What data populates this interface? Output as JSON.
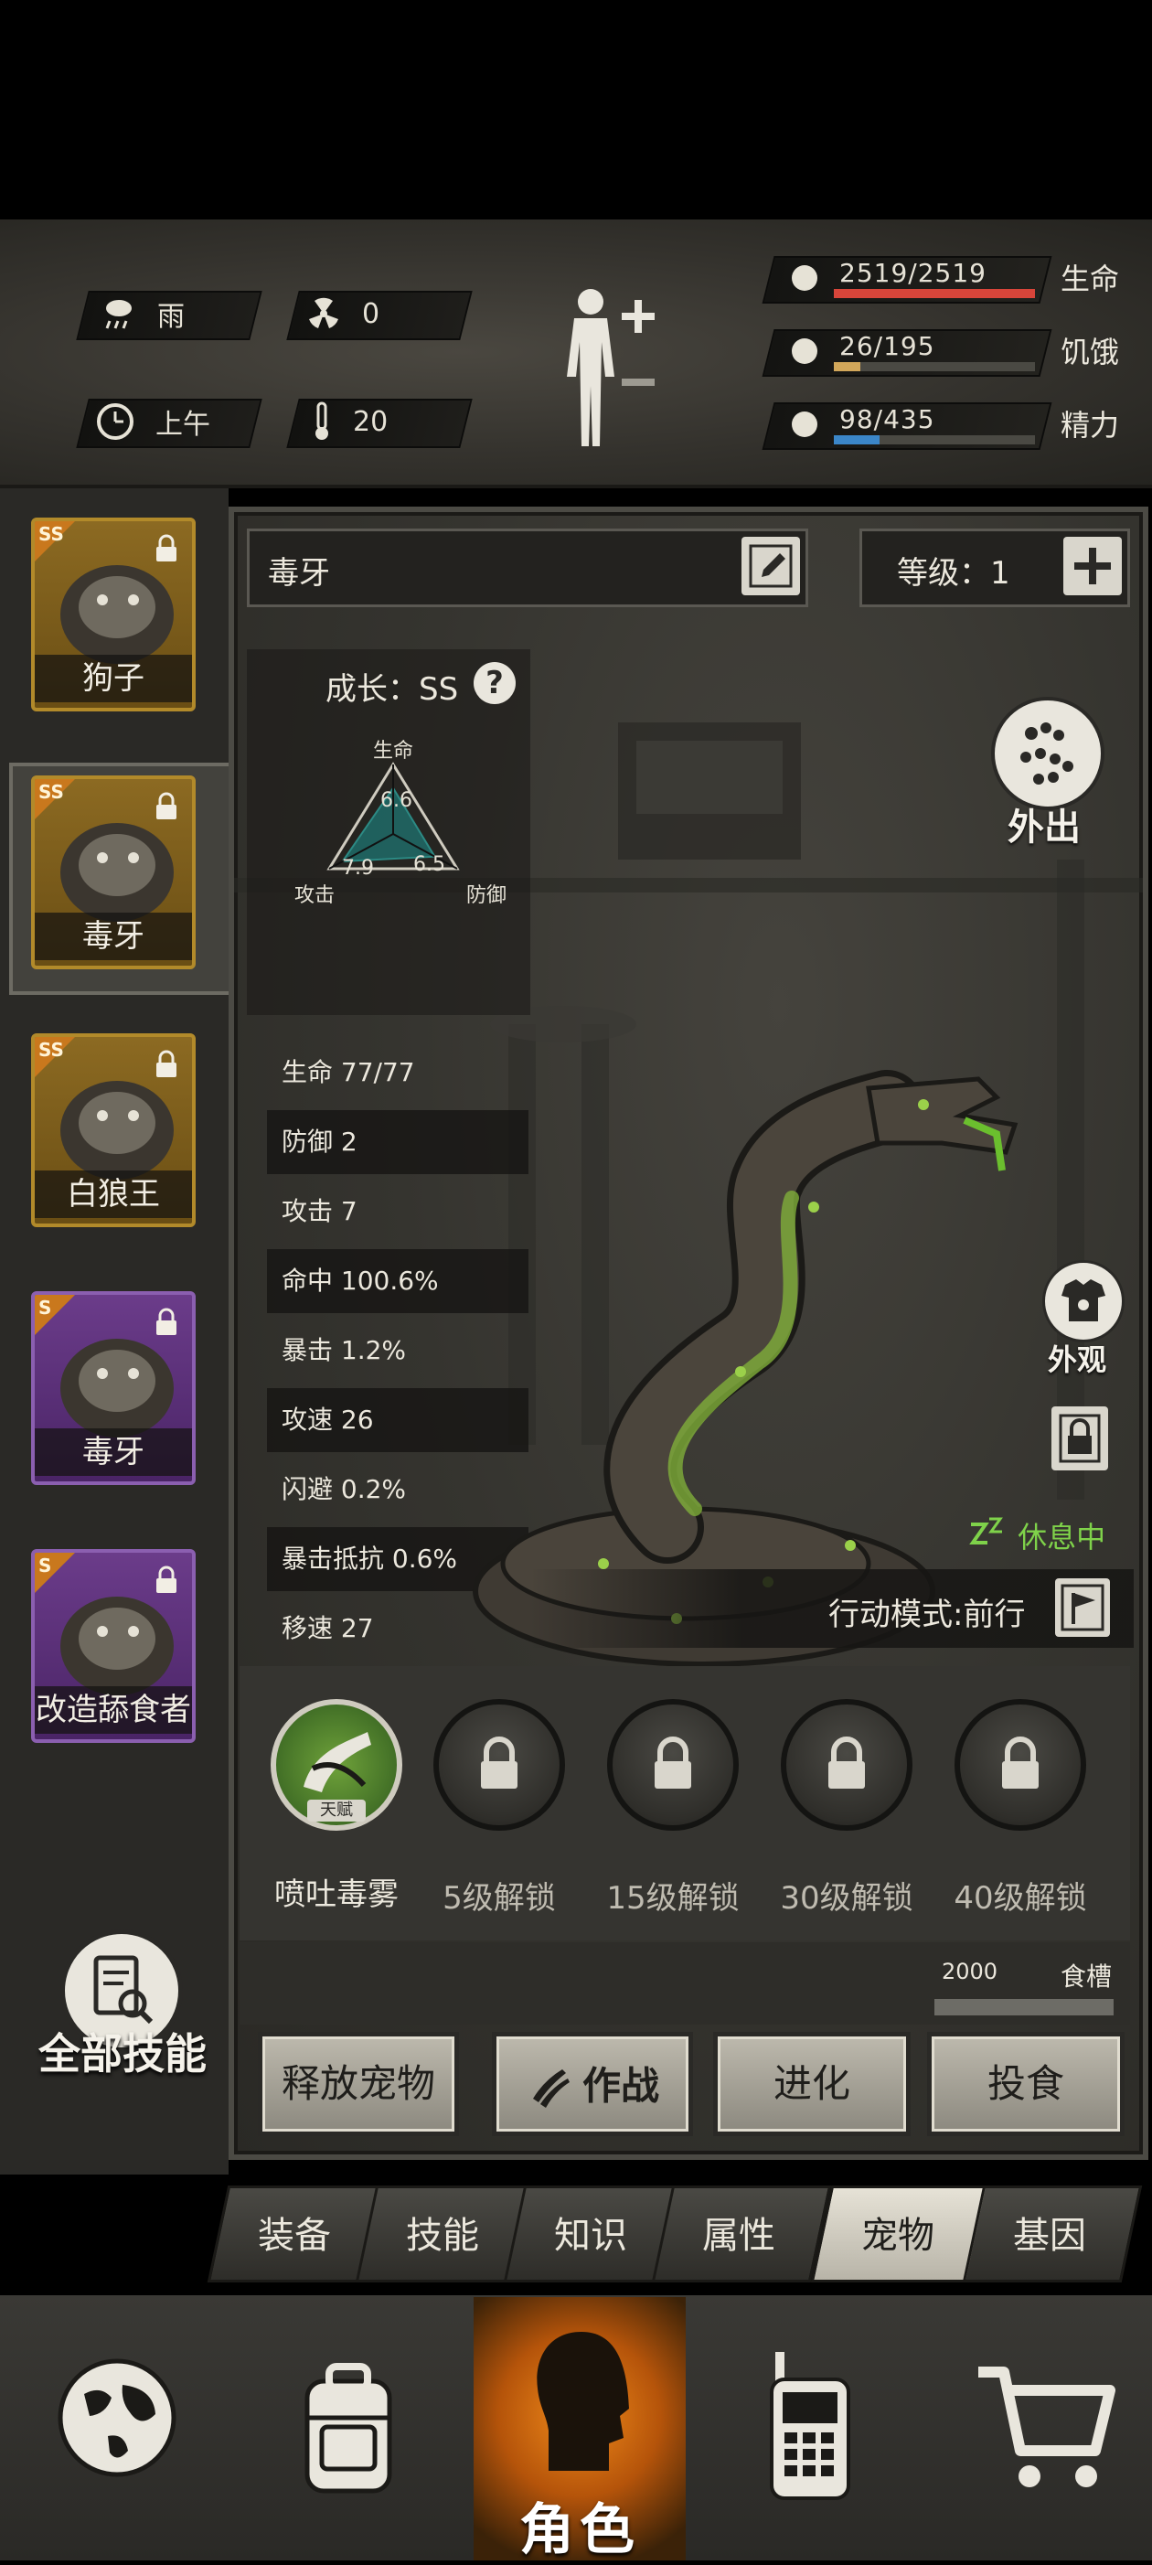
{
  "status": {
    "weather": "雨",
    "radiation": "0",
    "time_of_day": "上午",
    "temperature": "20"
  },
  "vitals": [
    {
      "name": "生命",
      "value": "2519/2519",
      "fill": 1.0,
      "color": "#d8453a",
      "icon": "heart-icon"
    },
    {
      "name": "饥饿",
      "value": "26/195",
      "fill": 0.133,
      "color": "#d2a75a",
      "icon": "stomach-icon"
    },
    {
      "name": "精力",
      "value": "98/435",
      "fill": 0.225,
      "color": "#3b86c8",
      "icon": "head-energy-icon"
    }
  ],
  "pets": [
    {
      "grade": "SS",
      "name": "狗子",
      "style": "gold",
      "selected": false
    },
    {
      "grade": "SS",
      "name": "毒牙",
      "style": "gold",
      "selected": true
    },
    {
      "grade": "SS",
      "name": "白狼王",
      "style": "gold",
      "selected": false
    },
    {
      "grade": "S",
      "name": "毒牙",
      "style": "purple",
      "selected": false
    },
    {
      "grade": "S",
      "name": "改造舔食者",
      "style": "purple",
      "selected": false
    }
  ],
  "pet_detail": {
    "name": "毒牙",
    "level_label": "等级：",
    "level_value": "1",
    "growth": "成长：SS",
    "radar": {
      "labels": {
        "top": "生命",
        "left": "攻击",
        "right": "防御"
      },
      "values": {
        "life": 6.6,
        "attack": 7.9,
        "defense": 6.5
      },
      "value_text": {
        "life": "6.6",
        "attack": "7.9",
        "defense": "6.5"
      }
    },
    "stats": [
      "生命 77/77",
      "防御 2",
      "攻击 7",
      "命中 100.6%",
      "暴击 1.2%",
      "攻速 26",
      "闪避 0.2%",
      "暴击抵抗 0.6%",
      "移速 27"
    ],
    "outing_label": "外出",
    "appearance_label": "外观",
    "status_text": "休息中",
    "mode_text": "行动模式:前行"
  },
  "skills": [
    {
      "label": "喷吐毒雾",
      "badge": "天赋",
      "locked": false
    },
    {
      "label": "5级解锁",
      "locked": true
    },
    {
      "label": "15级解锁",
      "locked": true
    },
    {
      "label": "30级解锁",
      "locked": true
    },
    {
      "label": "40级解锁",
      "locked": true
    }
  ],
  "food": {
    "value": "2000",
    "label": "食槽",
    "fill": 1.0
  },
  "actions": [
    "释放宠物",
    "作战",
    "进化",
    "投食"
  ],
  "all_skills_label": "全部技能",
  "tabs": [
    {
      "label": "装备",
      "selected": false
    },
    {
      "label": "技能",
      "selected": false
    },
    {
      "label": "知识",
      "selected": false
    },
    {
      "label": "属性",
      "selected": false
    },
    {
      "label": "宠物",
      "selected": true
    },
    {
      "label": "基因",
      "selected": false
    }
  ],
  "nav": [
    {
      "icon": "globe-icon"
    },
    {
      "icon": "backpack-icon"
    },
    {
      "icon": "character-head-icon",
      "label": "角色",
      "selected": true
    },
    {
      "icon": "walkie-talkie-icon"
    },
    {
      "icon": "shopping-cart-icon"
    }
  ]
}
